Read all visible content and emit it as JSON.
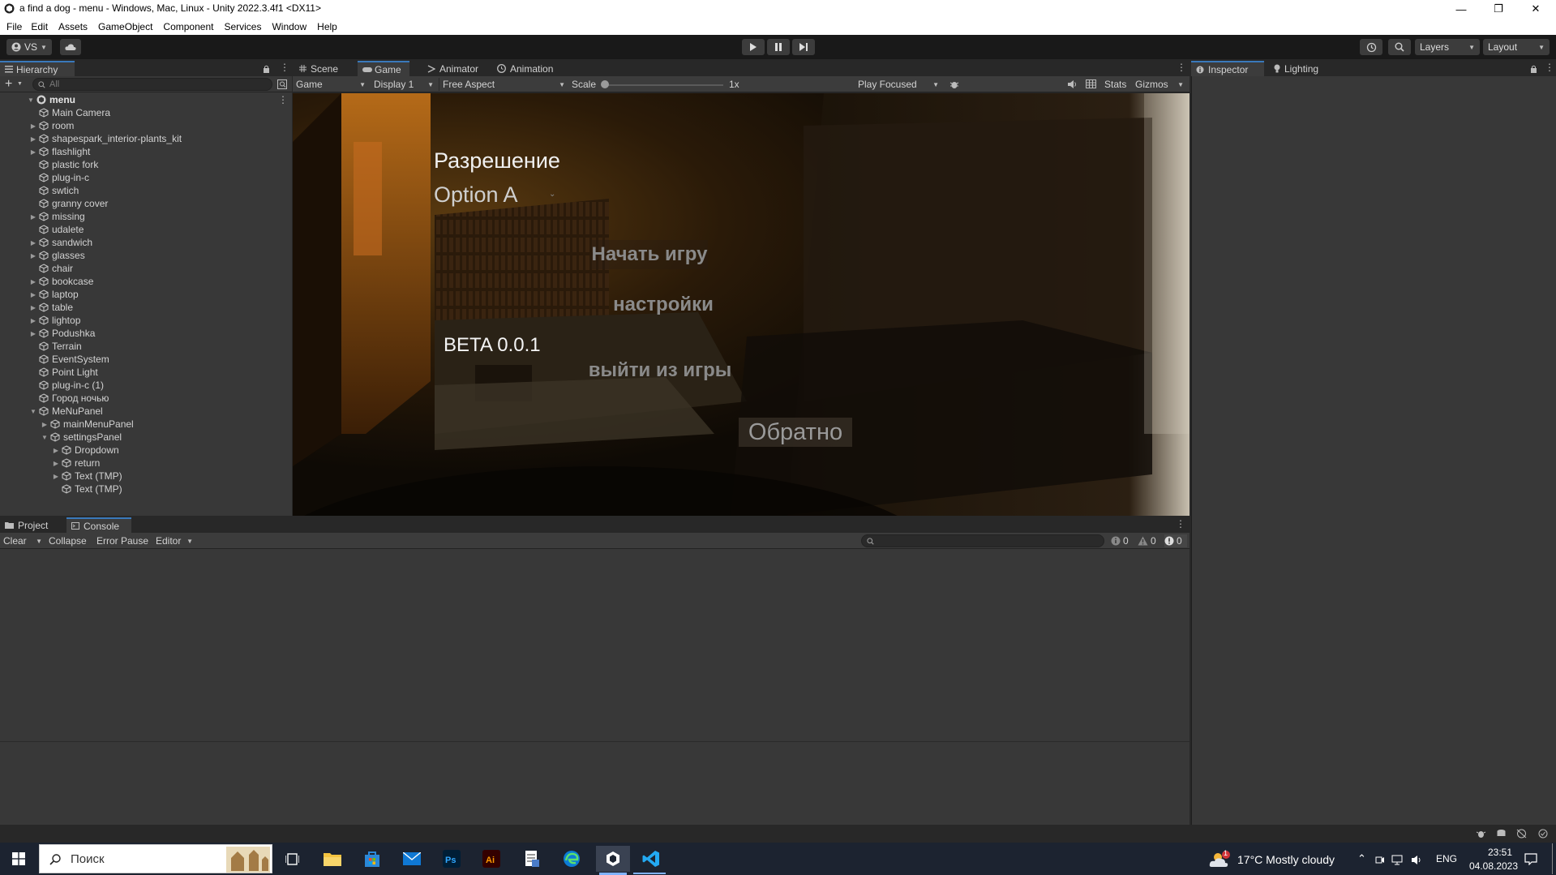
{
  "window": {
    "title": "a find a dog - menu - Windows, Mac, Linux - Unity 2022.3.4f1 <DX11>",
    "minimize": "—",
    "maximize": "❐",
    "close": "✕"
  },
  "menubar": [
    "File",
    "Edit",
    "Assets",
    "GameObject",
    "Component",
    "Services",
    "Window",
    "Help"
  ],
  "toolbar": {
    "vs_label": "VS",
    "layers_label": "Layers",
    "layout_label": "Layout"
  },
  "hierarchy": {
    "tab_label": "Hierarchy",
    "search_placeholder": "All",
    "scene_name": "menu",
    "items": [
      {
        "label": "Main Camera",
        "depth": 1,
        "expandable": false
      },
      {
        "label": "room",
        "depth": 1,
        "expandable": true
      },
      {
        "label": "shapespark_interior-plants_kit",
        "depth": 1,
        "expandable": true
      },
      {
        "label": "flashlight",
        "depth": 1,
        "expandable": true
      },
      {
        "label": "plastic fork",
        "depth": 1,
        "expandable": false
      },
      {
        "label": "plug-in-c",
        "depth": 1,
        "expandable": false
      },
      {
        "label": "swtich",
        "depth": 1,
        "expandable": false
      },
      {
        "label": "granny cover",
        "depth": 1,
        "expandable": false
      },
      {
        "label": "missing",
        "depth": 1,
        "expandable": true
      },
      {
        "label": "udalete",
        "depth": 1,
        "expandable": false
      },
      {
        "label": "sandwich",
        "depth": 1,
        "expandable": true
      },
      {
        "label": "glasses",
        "depth": 1,
        "expandable": true
      },
      {
        "label": "chair",
        "depth": 1,
        "expandable": false
      },
      {
        "label": "bookcase",
        "depth": 1,
        "expandable": true
      },
      {
        "label": "laptop",
        "depth": 1,
        "expandable": true
      },
      {
        "label": "table",
        "depth": 1,
        "expandable": true
      },
      {
        "label": "lightop",
        "depth": 1,
        "expandable": true
      },
      {
        "label": "Podushka",
        "depth": 1,
        "expandable": true
      },
      {
        "label": "Terrain",
        "depth": 1,
        "expandable": false
      },
      {
        "label": "EventSystem",
        "depth": 1,
        "expandable": false
      },
      {
        "label": "Point Light",
        "depth": 1,
        "expandable": false
      },
      {
        "label": "plug-in-c (1)",
        "depth": 1,
        "expandable": false
      },
      {
        "label": "Город ночью",
        "depth": 1,
        "expandable": false
      },
      {
        "label": "MeNuPanel",
        "depth": 1,
        "expandable": true,
        "expanded": true
      },
      {
        "label": "mainMenuPanel",
        "depth": 2,
        "expandable": true
      },
      {
        "label": "settingsPanel",
        "depth": 2,
        "expandable": true,
        "expanded": true
      },
      {
        "label": "Dropdown",
        "depth": 3,
        "expandable": true
      },
      {
        "label": "return",
        "depth": 3,
        "expandable": true
      },
      {
        "label": "Text (TMP)",
        "depth": 3,
        "expandable": true
      },
      {
        "label": "Text (TMP)",
        "depth": 3,
        "expandable": false
      }
    ]
  },
  "center_tabs": [
    "Scene",
    "Game",
    "Animator",
    "Animation"
  ],
  "game_bar": {
    "mode": "Game",
    "display": "Display 1",
    "aspect": "Free Aspect",
    "scale_label": "Scale",
    "scale_value": "1x",
    "scale_fraction": 0.0,
    "play_mode": "Play Focused",
    "stats": "Stats",
    "gizmos": "Gizmos"
  },
  "game_ui": {
    "resolution_label": "Разрешение",
    "resolution_value": "Option A",
    "start_game": "Начать игру",
    "settings": "настройки",
    "exit_game": "выйти из игры",
    "back": "Обратно",
    "version": "BETA 0.0.1"
  },
  "inspector_tabs": [
    "Inspector",
    "Lighting"
  ],
  "console": {
    "tabs": [
      "Project",
      "Console"
    ],
    "clear": "Clear",
    "collapse": "Collapse",
    "error_pause": "Error Pause",
    "editor": "Editor",
    "log_count": "0",
    "warn_count": "0",
    "error_count": "0"
  },
  "taskbar": {
    "search_placeholder": "Поиск",
    "weather": "17°C  Mostly cloudy",
    "weather_badge": "1",
    "lang": "ENG",
    "time": "23:51",
    "date": "04.08.2023"
  },
  "colors": {
    "unity_dark": "#383838",
    "toolbar": "#191919",
    "accent": "#3a79bb",
    "taskbar": "#1c2330"
  }
}
